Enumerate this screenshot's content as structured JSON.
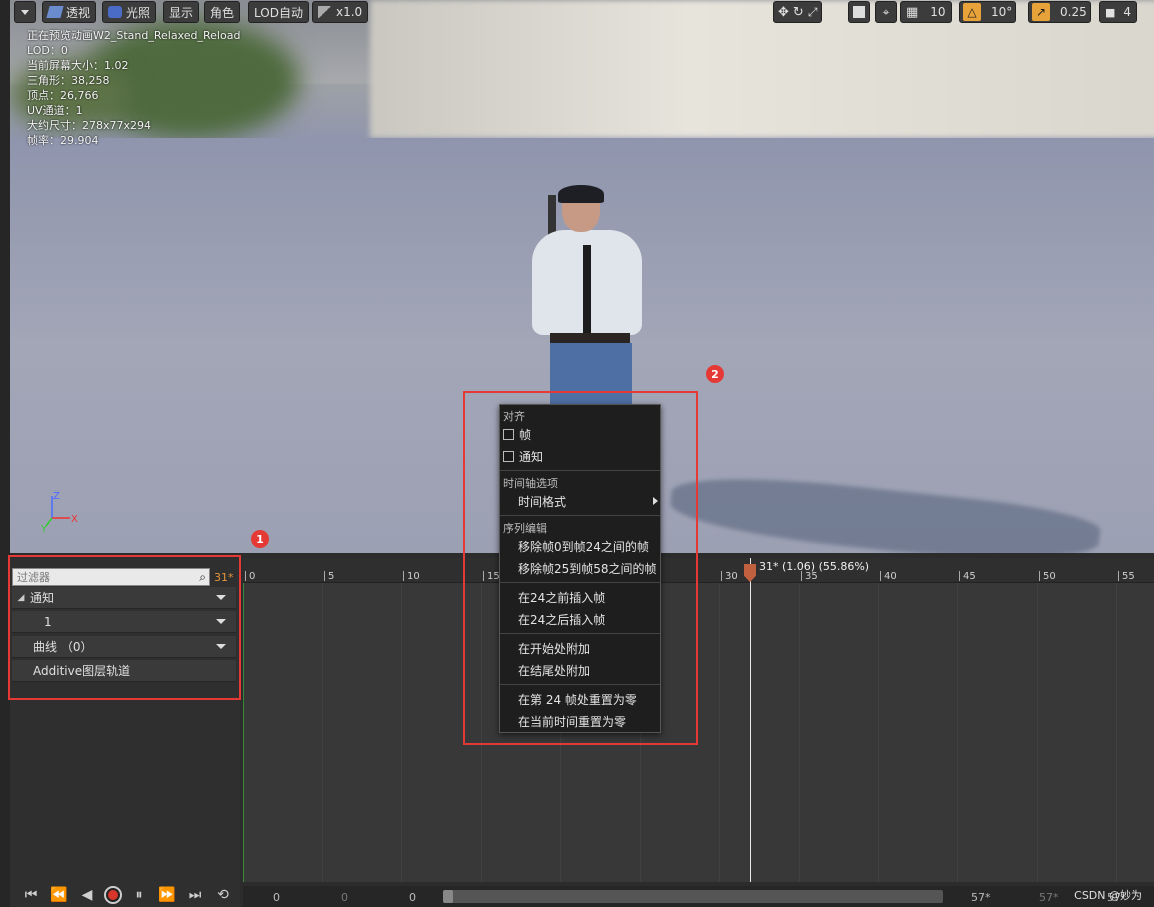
{
  "toolbar": {
    "menu_icon": "chevron-down-icon",
    "perspective_label": "透视",
    "lighting_label": "光照",
    "show_label": "显示",
    "character_label": "角色",
    "lod_label": "LOD自动",
    "speed_label": "x1.0",
    "grid_size": "10",
    "rotation_snap": "10°",
    "scale_snap": "0.25",
    "camera_speed": "4"
  },
  "stats": {
    "line1": "正在预览动画W2_Stand_Relaxed_Reload",
    "line2": "LOD：0",
    "line3": "当前屏幕大小：1.02",
    "line4": "三角形：38,258",
    "line5": "顶点：26,766",
    "line6": "UV通道：1",
    "line7": "大约尺寸：278x77x294",
    "line8": "帧率：29.904"
  },
  "axis": {
    "z": "Z",
    "y": "Y",
    "x": "X"
  },
  "badges": {
    "one": "1",
    "two": "2"
  },
  "tracks": {
    "filter_placeholder": "过滤器",
    "frame_count": "31*",
    "notify_label": "通知",
    "notify_sub": "1",
    "curves_label": "曲线 （0）",
    "additive_label": "Additive图层轨道"
  },
  "ruler": {
    "ticks": [
      "0",
      "5",
      "10",
      "15",
      "30",
      "35",
      "40",
      "45",
      "50",
      "55"
    ],
    "playhead_label": "31* (1.06) (55.86%)"
  },
  "scrub": {
    "start_a": "0",
    "start_b": "0",
    "start_c": "0",
    "end_a": "57*",
    "end_b": "57*",
    "end_c": "57*"
  },
  "context_menu": {
    "snap_header": "对齐",
    "snap_frame": "帧",
    "snap_notify": "通知",
    "timeline_header": "时间轴选项",
    "time_format": "时间格式",
    "sequence_header": "序列编辑",
    "remove_0_24": "移除帧0到帧24之间的帧",
    "remove_25_58": "移除帧25到帧58之间的帧",
    "insert_before": "在24之前插入帧",
    "insert_after": "在24之后插入帧",
    "append_start": "在开始处附加",
    "append_end": "在结尾处附加",
    "reset_at_24": "在第 24 帧处重置为零",
    "reset_current": "在当前时间重置为零"
  },
  "watermark": "CSDN @妙为"
}
